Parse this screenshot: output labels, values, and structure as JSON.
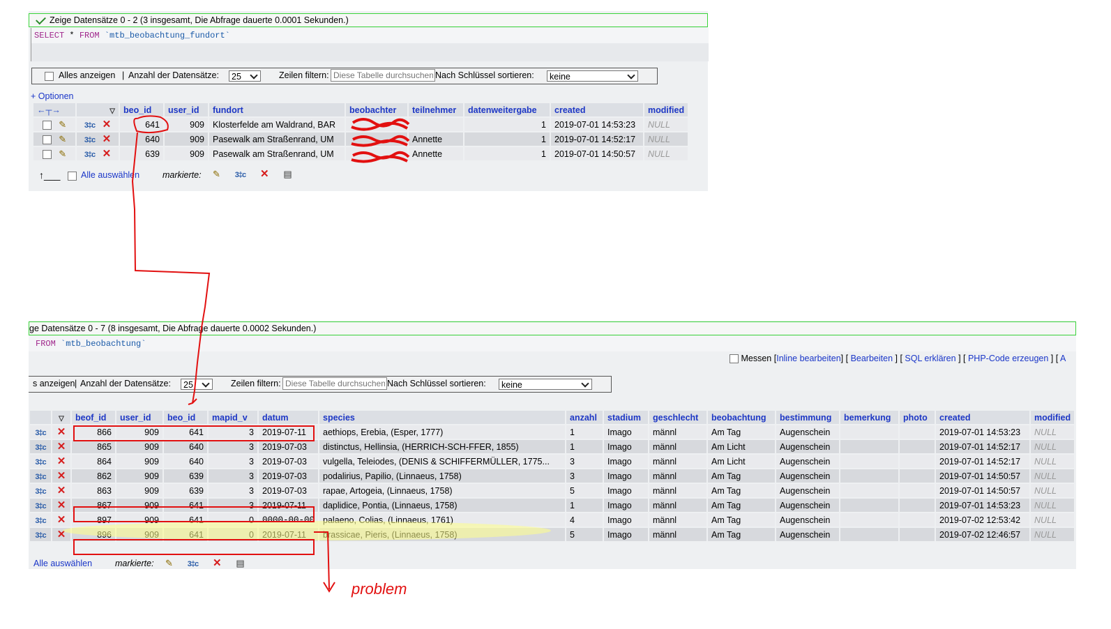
{
  "top": {
    "message": "Zeige Datensätze 0 - 2 (3 insgesamt, Die Abfrage dauerte 0.0001 Sekunden.)",
    "sql": {
      "kw1": "SELECT",
      "star": " * ",
      "kw2": "FROM",
      "table": " `mtb_beobachtung_fundort`"
    },
    "nav": {
      "show_all": "Alles anzeigen",
      "sep": "|",
      "rows_label": "Anzahl der Datensätze:",
      "rows_value": "25",
      "filter_label": "Zeilen filtern:",
      "filter_placeholder": "Diese Tabelle durchsuchen",
      "sort_label": "Nach Schlüssel sortieren:",
      "sort_value": "keine"
    },
    "options": "+ Optionen",
    "columns": [
      "beo_id",
      "user_id",
      "fundort",
      "beobachter",
      "teilnehmer",
      "datenweitergabe",
      "created",
      "modified"
    ],
    "rows": [
      {
        "beo_id": "641",
        "user_id": "909",
        "fundort": "Klosterfelde am Waldrand, BAR",
        "beobachter": "",
        "teilnehmer": "",
        "datenweitergabe": "1",
        "created": "2019-07-01 14:53:23",
        "modified": "NULL"
      },
      {
        "beo_id": "640",
        "user_id": "909",
        "fundort": "Pasewalk am Straßenrand, UM",
        "beobachter": "",
        "teilnehmer": "Annette",
        "datenweitergabe": "1",
        "created": "2019-07-01 14:52:17",
        "modified": "NULL"
      },
      {
        "beo_id": "639",
        "user_id": "909",
        "fundort": "Pasewalk am Straßenrand, UM",
        "beobachter": "",
        "teilnehmer": "Annette",
        "datenweitergabe": "1",
        "created": "2019-07-01 14:50:57",
        "modified": "NULL"
      }
    ],
    "select_all": "Alle auswählen",
    "marked": "markierte:"
  },
  "bottom": {
    "message": "ge Datensätze 0 - 7 (8 insgesamt, Die Abfrage dauerte 0.0002 Sekunden.)",
    "sql": {
      "kw2": "FROM",
      "table": " `mtb_beobachtung`"
    },
    "actions": {
      "measure": "Messen",
      "inline_edit": "Inline bearbeiten",
      "edit": "Bearbeiten",
      "explain": "SQL erklären",
      "php": "PHP-Code erzeugen",
      "trailing": "A"
    },
    "nav": {
      "show_all": "s anzeigen",
      "sep": "|",
      "rows_label": "Anzahl der Datensätze:",
      "rows_value": "25",
      "filter_label": "Zeilen filtern:",
      "filter_placeholder": "Diese Tabelle durchsuchen",
      "sort_label": "Nach Schlüssel sortieren:",
      "sort_value": "keine"
    },
    "columns": [
      "beof_id",
      "user_id",
      "beo_id",
      "mapid_v",
      "datum",
      "species",
      "anzahl",
      "stadium",
      "geschlecht",
      "beobachtung",
      "bestimmung",
      "bemerkung",
      "photo",
      "created",
      "modified"
    ],
    "rows": [
      {
        "beof_id": "866",
        "user_id": "909",
        "beo_id": "641",
        "mapid_v": "3",
        "datum": "2019-07-11",
        "species": "aethiops, Erebia, (Esper, 1777)",
        "anzahl": "1",
        "stadium": "Imago",
        "geschlecht": "männl",
        "beobachtung": "Am Tag",
        "bestimmung": "Augenschein",
        "bemerkung": "",
        "photo": "",
        "created": "2019-07-01 14:53:23",
        "modified": "NULL"
      },
      {
        "beof_id": "865",
        "user_id": "909",
        "beo_id": "640",
        "mapid_v": "3",
        "datum": "2019-07-03",
        "species": "distinctus, Hellinsia, (HERRICH-SCH-FFER, 1855)",
        "anzahl": "1",
        "stadium": "Imago",
        "geschlecht": "männl",
        "beobachtung": "Am Licht",
        "bestimmung": "Augenschein",
        "bemerkung": "",
        "photo": "",
        "created": "2019-07-01 14:52:17",
        "modified": "NULL"
      },
      {
        "beof_id": "864",
        "user_id": "909",
        "beo_id": "640",
        "mapid_v": "3",
        "datum": "2019-07-03",
        "species": "vulgella, Teleiodes, (DENIS & SCHIFFERMÜLLER, 1775...",
        "anzahl": "3",
        "stadium": "Imago",
        "geschlecht": "männl",
        "beobachtung": "Am Licht",
        "bestimmung": "Augenschein",
        "bemerkung": "",
        "photo": "",
        "created": "2019-07-01 14:52:17",
        "modified": "NULL"
      },
      {
        "beof_id": "862",
        "user_id": "909",
        "beo_id": "639",
        "mapid_v": "3",
        "datum": "2019-07-03",
        "species": "podalirius, Papilio, (Linnaeus, 1758)",
        "anzahl": "3",
        "stadium": "Imago",
        "geschlecht": "männl",
        "beobachtung": "Am Tag",
        "bestimmung": "Augenschein",
        "bemerkung": "",
        "photo": "",
        "created": "2019-07-01 14:50:57",
        "modified": "NULL"
      },
      {
        "beof_id": "863",
        "user_id": "909",
        "beo_id": "639",
        "mapid_v": "3",
        "datum": "2019-07-03",
        "species": "rapae, Artogeia, (Linnaeus, 1758)",
        "anzahl": "5",
        "stadium": "Imago",
        "geschlecht": "männl",
        "beobachtung": "Am Tag",
        "bestimmung": "Augenschein",
        "bemerkung": "",
        "photo": "",
        "created": "2019-07-01 14:50:57",
        "modified": "NULL"
      },
      {
        "beof_id": "867",
        "user_id": "909",
        "beo_id": "641",
        "mapid_v": "3",
        "datum": "2019-07-11",
        "species": "daplidice, Pontia, (Linnaeus, 1758)",
        "anzahl": "1",
        "stadium": "Imago",
        "geschlecht": "männl",
        "beobachtung": "Am Tag",
        "bestimmung": "Augenschein",
        "bemerkung": "",
        "photo": "",
        "created": "2019-07-01 14:53:23",
        "modified": "NULL"
      },
      {
        "beof_id": "897",
        "user_id": "909",
        "beo_id": "641",
        "mapid_v": "0",
        "datum": "0000-00-00",
        "species": "palaeno, Colias, (Linnaeus, 1761)",
        "anzahl": "4",
        "stadium": "Imago",
        "geschlecht": "männl",
        "beobachtung": "Am Tag",
        "bestimmung": "Augenschein",
        "bemerkung": "",
        "photo": "",
        "created": "2019-07-02 12:53:42",
        "modified": "NULL"
      },
      {
        "beof_id": "896",
        "user_id": "909",
        "beo_id": "641",
        "mapid_v": "0",
        "datum": "2019-07-11",
        "species": "brassicae, Pieris, (Linnaeus, 1758)",
        "anzahl": "5",
        "stadium": "Imago",
        "geschlecht": "männl",
        "beobachtung": "Am Tag",
        "bestimmung": "Augenschein",
        "bemerkung": "",
        "photo": "",
        "created": "2019-07-02 12:46:57",
        "modified": "NULL"
      }
    ],
    "select_all": "Alle auswählen",
    "marked": "markierte:"
  },
  "annotation": {
    "label": "problem",
    "color": "#e21010"
  },
  "colors": {
    "header_link": "#1d37c5",
    "row_odd": "#e9eaed",
    "row_even": "#d7d9dd",
    "success_border": "#3ad43a",
    "highlight": "#ffff99"
  }
}
